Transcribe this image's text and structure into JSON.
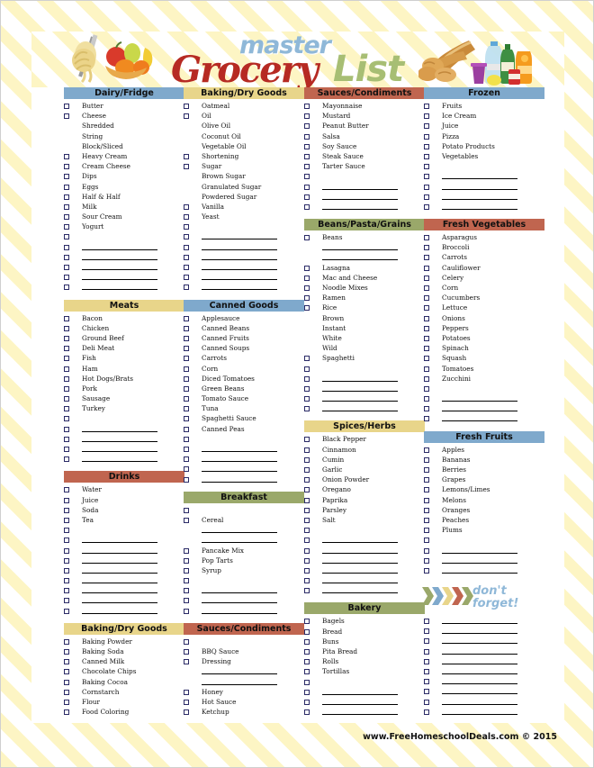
{
  "header": {
    "title_master": "master",
    "title_grocery": "Grocery",
    "title_list": "List",
    "art_left": "pasta-fruit-illustration",
    "art_right": "bread-drinks-illustration"
  },
  "footer": {
    "text": "www.FreeHomeschoolDeals.com © 2015"
  },
  "dont_forget": {
    "line1": "don't",
    "line2": "forget!",
    "chevrons": [
      "#9AA86A",
      "#7FA9CC",
      "#E8D58A",
      "#C0654F",
      "#9AA86A"
    ]
  },
  "colors": {
    "blue": "#7FA9CC",
    "yellow": "#E8D58A",
    "red": "#C0654F",
    "green": "#9AA86A",
    "stripe": "#FDF5C4",
    "logo_red": "#B62A23",
    "logo_green": "#A7BE74",
    "logo_blue": "#8FB8D8"
  },
  "columns": [
    {
      "sections": [
        {
          "title": "Dairy/Fridge",
          "color": "blue",
          "rows": [
            {
              "type": "item",
              "label": "Butter"
            },
            {
              "type": "item",
              "label": "Cheese"
            },
            {
              "type": "sub",
              "label": "Shredded"
            },
            {
              "type": "sub",
              "label": "String"
            },
            {
              "type": "sub",
              "label": "Block/Sliced"
            },
            {
              "type": "item",
              "label": "Heavy Cream"
            },
            {
              "type": "item",
              "label": "Cream Cheese"
            },
            {
              "type": "item",
              "label": "Dips"
            },
            {
              "type": "item",
              "label": "Eggs"
            },
            {
              "type": "item",
              "label": "Half & Half"
            },
            {
              "type": "item",
              "label": "Milk"
            },
            {
              "type": "item",
              "label": "Sour Cream"
            },
            {
              "type": "item",
              "label": "Yogurt"
            },
            {
              "type": "blank"
            },
            {
              "type": "line"
            },
            {
              "type": "line"
            },
            {
              "type": "line"
            },
            {
              "type": "line"
            },
            {
              "type": "line"
            }
          ]
        },
        {
          "title": "Meats",
          "color": "yellow",
          "rows": [
            {
              "type": "item",
              "label": "Bacon"
            },
            {
              "type": "item",
              "label": "Chicken"
            },
            {
              "type": "item",
              "label": "Ground Beef"
            },
            {
              "type": "item",
              "label": "Deli Meat"
            },
            {
              "type": "item",
              "label": "Fish"
            },
            {
              "type": "item",
              "label": "Ham"
            },
            {
              "type": "item",
              "label": "Hot Dogs/Brats"
            },
            {
              "type": "item",
              "label": "Pork"
            },
            {
              "type": "item",
              "label": "Sausage"
            },
            {
              "type": "item",
              "label": "Turkey"
            },
            {
              "type": "blank"
            },
            {
              "type": "line"
            },
            {
              "type": "line"
            },
            {
              "type": "line"
            },
            {
              "type": "line"
            }
          ]
        },
        {
          "title": "Drinks",
          "color": "red",
          "rows": [
            {
              "type": "item",
              "label": "Water"
            },
            {
              "type": "item",
              "label": "Juice"
            },
            {
              "type": "item",
              "label": "Soda"
            },
            {
              "type": "item",
              "label": "Tea"
            },
            {
              "type": "blank"
            },
            {
              "type": "line"
            },
            {
              "type": "line"
            },
            {
              "type": "line"
            },
            {
              "type": "line"
            },
            {
              "type": "line"
            },
            {
              "type": "line"
            },
            {
              "type": "line"
            },
            {
              "type": "line"
            }
          ]
        },
        {
          "title": "Baking/Dry Goods",
          "color": "yellow",
          "rows": [
            {
              "type": "item",
              "label": "Baking Powder"
            },
            {
              "type": "item",
              "label": "Baking Soda"
            },
            {
              "type": "item",
              "label": "Canned Milk"
            },
            {
              "type": "item",
              "label": "Chocolate Chips"
            },
            {
              "type": "item",
              "label": "Baking Cocoa"
            },
            {
              "type": "item",
              "label": "Cornstarch"
            },
            {
              "type": "item",
              "label": "Flour"
            },
            {
              "type": "item",
              "label": "Food Coloring"
            }
          ]
        }
      ]
    },
    {
      "sections": [
        {
          "title": "Baking/Dry Goods",
          "color": "yellow",
          "rows": [
            {
              "type": "item",
              "label": "Oatmeal"
            },
            {
              "type": "item",
              "label": "Oil"
            },
            {
              "type": "sub",
              "label": "Olive Oil"
            },
            {
              "type": "sub",
              "label": "Coconut Oil"
            },
            {
              "type": "sub",
              "label": "Vegetable Oil"
            },
            {
              "type": "item",
              "label": "Shortening"
            },
            {
              "type": "item",
              "label": "Sugar"
            },
            {
              "type": "sub",
              "label": "Brown Sugar"
            },
            {
              "type": "sub",
              "label": "Granulated Sugar"
            },
            {
              "type": "sub",
              "label": "Powdered Sugar"
            },
            {
              "type": "item",
              "label": "Vanilla"
            },
            {
              "type": "item",
              "label": "Yeast"
            },
            {
              "type": "blank"
            },
            {
              "type": "line"
            },
            {
              "type": "line"
            },
            {
              "type": "line"
            },
            {
              "type": "line"
            },
            {
              "type": "line"
            },
            {
              "type": "line"
            }
          ]
        },
        {
          "title": "Canned Goods",
          "color": "blue",
          "rows": [
            {
              "type": "item",
              "label": "Applesauce"
            },
            {
              "type": "item",
              "label": "Canned Beans"
            },
            {
              "type": "item",
              "label": "Canned Fruits"
            },
            {
              "type": "item",
              "label": "Canned Soups"
            },
            {
              "type": "item",
              "label": "Carrots"
            },
            {
              "type": "item",
              "label": "Corn"
            },
            {
              "type": "item",
              "label": "Diced Tomatoes"
            },
            {
              "type": "item",
              "label": "Green Beans"
            },
            {
              "type": "item",
              "label": "Tomato Sauce"
            },
            {
              "type": "item",
              "label": "Tuna"
            },
            {
              "type": "item",
              "label": "Spaghetti Sauce"
            },
            {
              "type": "item",
              "label": "Canned Peas"
            },
            {
              "type": "blank"
            },
            {
              "type": "line"
            },
            {
              "type": "line"
            },
            {
              "type": "line"
            },
            {
              "type": "line"
            }
          ]
        },
        {
          "title": "Breakfast",
          "color": "green",
          "rows": [
            {
              "type": "blank"
            },
            {
              "type": "item",
              "label": "Cereal"
            },
            {
              "type": "lineonly"
            },
            {
              "type": "lineonly"
            },
            {
              "type": "item",
              "label": "Pancake Mix"
            },
            {
              "type": "item",
              "label": "Pop Tarts"
            },
            {
              "type": "item",
              "label": "Syrup"
            },
            {
              "type": "blank"
            },
            {
              "type": "line"
            },
            {
              "type": "line"
            },
            {
              "type": "line"
            }
          ]
        },
        {
          "title": "Sauces/Condiments",
          "color": "red",
          "rows": [
            {
              "type": "blank"
            },
            {
              "type": "item",
              "label": "BBQ Sauce"
            },
            {
              "type": "item",
              "label": "Dressing"
            },
            {
              "type": "lineonly"
            },
            {
              "type": "lineonly"
            },
            {
              "type": "item",
              "label": "Honey"
            },
            {
              "type": "item",
              "label": "Hot Sauce"
            },
            {
              "type": "item",
              "label": "Ketchup"
            }
          ]
        }
      ]
    },
    {
      "sections": [
        {
          "title": "Sauces/Condiments",
          "color": "red",
          "rows": [
            {
              "type": "item",
              "label": "Mayonnaise"
            },
            {
              "type": "item",
              "label": "Mustard"
            },
            {
              "type": "item",
              "label": "Peanut Butter"
            },
            {
              "type": "item",
              "label": "Salsa"
            },
            {
              "type": "item",
              "label": "Soy Sauce"
            },
            {
              "type": "item",
              "label": "Steak Sauce"
            },
            {
              "type": "item",
              "label": "Tarter Sauce"
            },
            {
              "type": "blank"
            },
            {
              "type": "line"
            },
            {
              "type": "line"
            },
            {
              "type": "line"
            }
          ]
        },
        {
          "title": "Beans/Pasta/Grains",
          "color": "green",
          "rows": [
            {
              "type": "item",
              "label": "Beans"
            },
            {
              "type": "lineonly"
            },
            {
              "type": "lineonly"
            },
            {
              "type": "item",
              "label": "Lasagna"
            },
            {
              "type": "item",
              "label": "Mac and Cheese"
            },
            {
              "type": "item",
              "label": "Noodle Mixes"
            },
            {
              "type": "item",
              "label": "Ramen"
            },
            {
              "type": "item",
              "label": "Rice"
            },
            {
              "type": "sub",
              "label": "Brown"
            },
            {
              "type": "sub",
              "label": "Instant"
            },
            {
              "type": "sub",
              "label": "White"
            },
            {
              "type": "sub",
              "label": "Wild"
            },
            {
              "type": "item",
              "label": "Spaghetti"
            },
            {
              "type": "blank"
            },
            {
              "type": "line"
            },
            {
              "type": "line"
            },
            {
              "type": "line"
            },
            {
              "type": "line"
            }
          ]
        },
        {
          "title": "Spices/Herbs",
          "color": "yellow",
          "rows": [
            {
              "type": "item",
              "label": "Black Pepper"
            },
            {
              "type": "item",
              "label": "Cinnamon"
            },
            {
              "type": "item",
              "label": "Cumin"
            },
            {
              "type": "item",
              "label": "Garlic"
            },
            {
              "type": "item",
              "label": "Onion Powder"
            },
            {
              "type": "item",
              "label": "Oregano"
            },
            {
              "type": "item",
              "label": "Paprika"
            },
            {
              "type": "item",
              "label": "Parsley"
            },
            {
              "type": "item",
              "label": "Salt"
            },
            {
              "type": "blank"
            },
            {
              "type": "line"
            },
            {
              "type": "line"
            },
            {
              "type": "line"
            },
            {
              "type": "line"
            },
            {
              "type": "line"
            },
            {
              "type": "line"
            }
          ]
        },
        {
          "title": "Bakery",
          "color": "green",
          "rows": [
            {
              "type": "item",
              "label": "Bagels"
            },
            {
              "type": "item",
              "label": "Bread"
            },
            {
              "type": "item",
              "label": "Buns"
            },
            {
              "type": "item",
              "label": "Pita Bread"
            },
            {
              "type": "item",
              "label": "Rolls"
            },
            {
              "type": "item",
              "label": "Tortillas"
            },
            {
              "type": "blank"
            },
            {
              "type": "line"
            },
            {
              "type": "line"
            },
            {
              "type": "line"
            }
          ]
        }
      ]
    },
    {
      "sections": [
        {
          "title": "Frozen",
          "color": "blue",
          "rows": [
            {
              "type": "item",
              "label": "Fruits"
            },
            {
              "type": "item",
              "label": "Ice Cream"
            },
            {
              "type": "item",
              "label": "Juice"
            },
            {
              "type": "item",
              "label": "Pizza"
            },
            {
              "type": "item",
              "label": "Potato Products"
            },
            {
              "type": "item",
              "label": "Vegetables"
            },
            {
              "type": "blank"
            },
            {
              "type": "line"
            },
            {
              "type": "line"
            },
            {
              "type": "line"
            },
            {
              "type": "line"
            }
          ]
        },
        {
          "title": "Fresh Vegetables",
          "color": "red",
          "rows": [
            {
              "type": "item",
              "label": "Asparagus"
            },
            {
              "type": "item",
              "label": "Broccoli"
            },
            {
              "type": "item",
              "label": "Carrots"
            },
            {
              "type": "item",
              "label": "Cauliflower"
            },
            {
              "type": "item",
              "label": "Celery"
            },
            {
              "type": "item",
              "label": "Corn"
            },
            {
              "type": "item",
              "label": "Cucumbers"
            },
            {
              "type": "item",
              "label": "Lettuce"
            },
            {
              "type": "item",
              "label": "Onions"
            },
            {
              "type": "item",
              "label": "Peppers"
            },
            {
              "type": "item",
              "label": "Potatoes"
            },
            {
              "type": "item",
              "label": "Spinach"
            },
            {
              "type": "item",
              "label": "Squash"
            },
            {
              "type": "item",
              "label": "Tomatoes"
            },
            {
              "type": "item",
              "label": "Zucchini"
            },
            {
              "type": "blank"
            },
            {
              "type": "line"
            },
            {
              "type": "line"
            },
            {
              "type": "line"
            }
          ]
        },
        {
          "title": "Fresh Fruits",
          "color": "blue",
          "rows": [
            {
              "type": "item",
              "label": "Apples"
            },
            {
              "type": "item",
              "label": "Bananas"
            },
            {
              "type": "item",
              "label": "Berries"
            },
            {
              "type": "item",
              "label": "Grapes"
            },
            {
              "type": "item",
              "label": "Lemons/Limes"
            },
            {
              "type": "item",
              "label": "Melons"
            },
            {
              "type": "item",
              "label": "Oranges"
            },
            {
              "type": "item",
              "label": "Peaches"
            },
            {
              "type": "item",
              "label": "Plums"
            },
            {
              "type": "blank"
            },
            {
              "type": "line"
            },
            {
              "type": "line"
            },
            {
              "type": "line"
            }
          ]
        },
        {
          "title": "__dontforget__",
          "color": "none",
          "rows": [
            {
              "type": "line"
            },
            {
              "type": "line"
            },
            {
              "type": "line"
            },
            {
              "type": "line"
            },
            {
              "type": "line"
            },
            {
              "type": "line"
            },
            {
              "type": "line"
            },
            {
              "type": "line"
            },
            {
              "type": "line"
            },
            {
              "type": "line"
            }
          ]
        }
      ]
    }
  ]
}
